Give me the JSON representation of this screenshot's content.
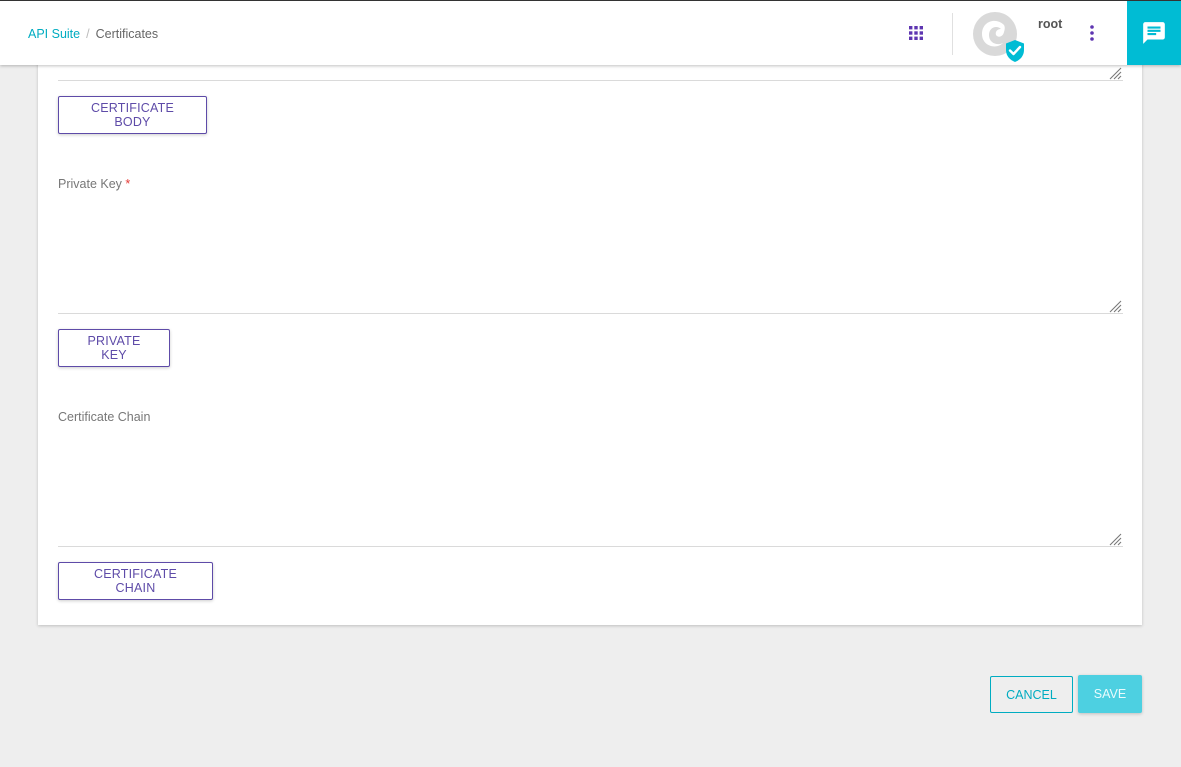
{
  "breadcrumb": {
    "root": "API Suite",
    "separator": "/",
    "current": "Certificates"
  },
  "header": {
    "apps_icon": "grid-apps-icon",
    "avatar_icon": "avatar-verified-icon",
    "username": "root",
    "more_icon": "more-vert-icon",
    "chat_icon": "chat-icon",
    "accent_color": "#00bcd4",
    "apps_color": "#5e35b1"
  },
  "form": {
    "certificate_body": {
      "button_label": "CERTIFICATE BODY"
    },
    "private_key": {
      "label": "Private Key",
      "required_mark": "*",
      "value": "",
      "button_label": "PRIVATE KEY"
    },
    "certificate_chain": {
      "label": "Certificate Chain",
      "value": "",
      "button_label": "CERTIFICATE CHAIN"
    }
  },
  "actions": {
    "cancel_label": "CANCEL",
    "save_label": "SAVE"
  }
}
